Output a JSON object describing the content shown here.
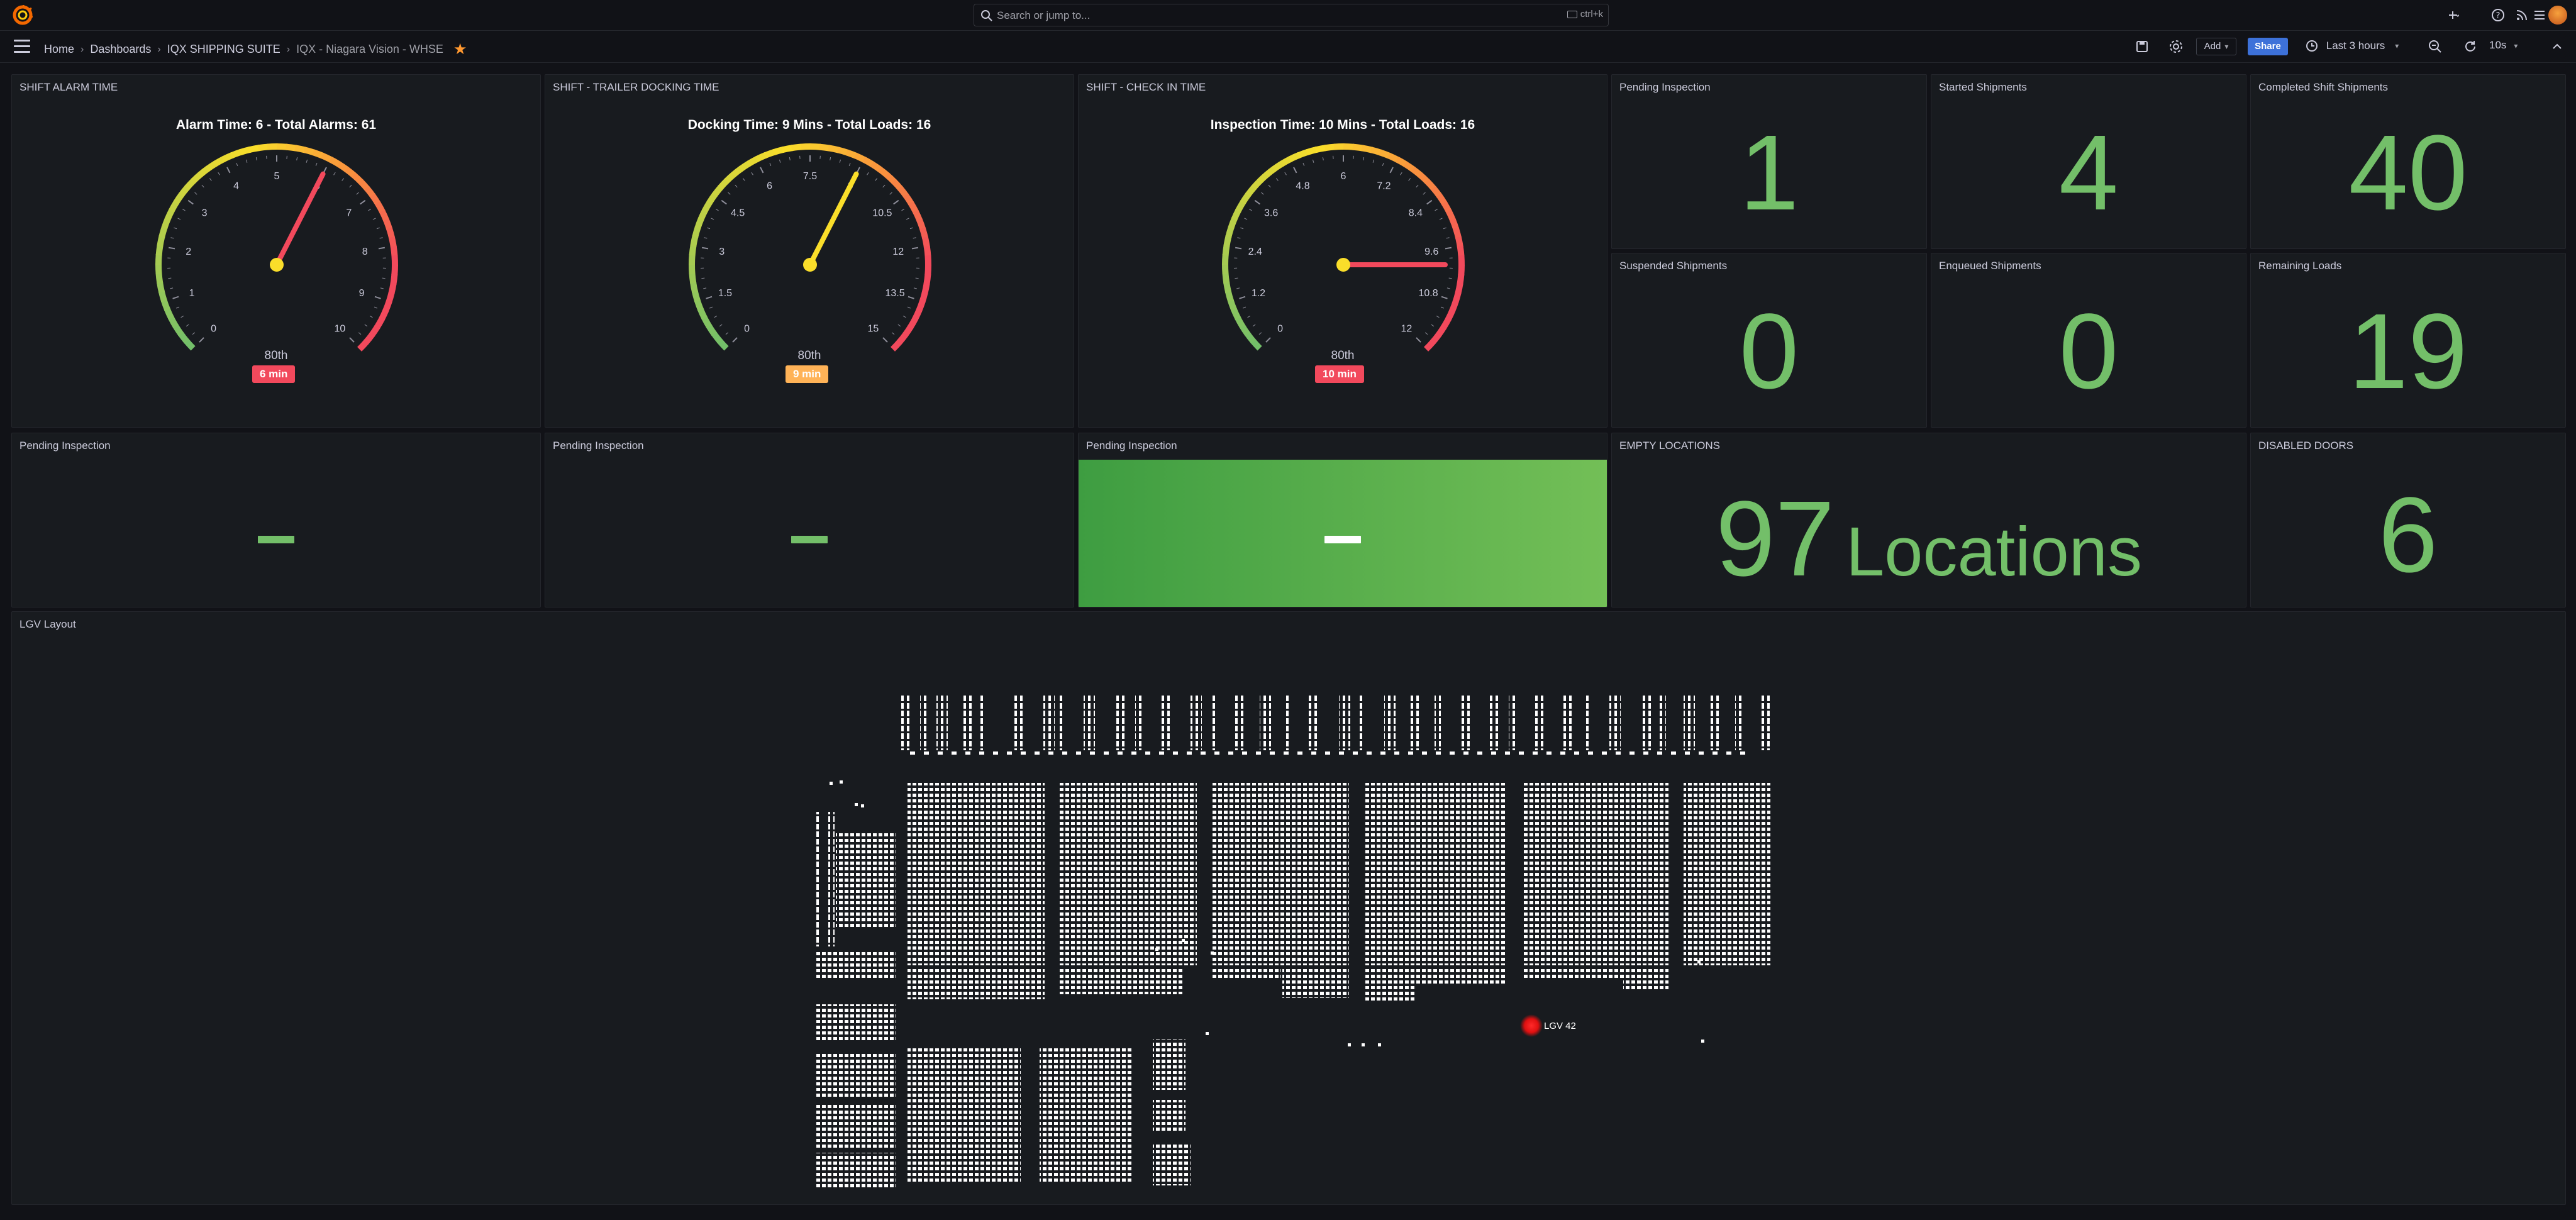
{
  "app": {
    "search_placeholder": "Search or jump to...",
    "search_shortcut": "ctrl+k"
  },
  "breadcrumb": [
    "Home",
    "Dashboards",
    "IQX SHIPPING SUITE",
    "IQX - Niagara Vision - WHSE"
  ],
  "toolbar": {
    "add_label": "Add",
    "share_label": "Share",
    "time_range": "Last 3 hours",
    "refresh_interval": "10s"
  },
  "colors": {
    "stat_green": "#73bf69",
    "gauge_red": "#f2495c",
    "gauge_yellow": "#fade2a",
    "share_blue": "#3d71d9",
    "badge_orange": "#ffb357",
    "star": "#ff9830"
  },
  "gauges": [
    {
      "title": "SHIFT ALARM TIME",
      "subtitle": "Alarm Time: 6 - Total Alarms: 61",
      "value": 6,
      "min": 0,
      "max": 10,
      "ticks": [
        "0",
        "1",
        "2",
        "3",
        "4",
        "5",
        "6",
        "7",
        "8",
        "9",
        "10"
      ],
      "percentile_label": "80th",
      "badge": "6 min",
      "badge_color": "#f2495c",
      "needle_color": "#f2495c"
    },
    {
      "title": "SHIFT - TRAILER DOCKING TIME",
      "subtitle": "Docking Time: 9 Mins - Total Loads: 16",
      "value": 9,
      "min": 0,
      "max": 15,
      "ticks": [
        "0",
        "1.5",
        "3",
        "4.5",
        "6",
        "7.5",
        "9",
        "10.5",
        "12",
        "13.5",
        "15"
      ],
      "percentile_label": "80th",
      "badge": "9 min",
      "badge_color": "#ffb357",
      "needle_color": "#fade2a"
    },
    {
      "title": "SHIFT - CHECK IN TIME",
      "subtitle": "Inspection Time: 10 Mins - Total Loads: 16",
      "value": 10,
      "min": 0,
      "max": 12,
      "ticks": [
        "0",
        "1.2",
        "2.4",
        "3.6",
        "4.8",
        "6",
        "7.2",
        "8.4",
        "9.6",
        "10.8",
        "12"
      ],
      "percentile_label": "80th",
      "badge": "10 min",
      "badge_color": "#f2495c",
      "needle_color": "#f2495c"
    }
  ],
  "stats": {
    "pending_inspection": {
      "title": "Pending Inspection",
      "value": "1"
    },
    "started_shipments": {
      "title": "Started Shipments",
      "value": "4"
    },
    "completed_shift_shipments": {
      "title": "Completed Shift Shipments",
      "value": "40"
    },
    "suspended_shipments": {
      "title": "Suspended Shipments",
      "value": "0"
    },
    "enqueued_shipments": {
      "title": "Enqueued Shipments",
      "value": "0"
    },
    "remaining_loads": {
      "title": "Remaining Loads",
      "value": "19"
    }
  },
  "row2": {
    "pending1": {
      "title": "Pending Inspection",
      "value": "-"
    },
    "pending2": {
      "title": "Pending Inspection",
      "value": "-"
    },
    "pending3": {
      "title": "Pending Inspection",
      "value": "-"
    },
    "empty_locations": {
      "title": "EMPTY LOCATIONS",
      "value": "97",
      "unit": "Locations"
    },
    "disabled_doors": {
      "title": "DISABLED DOORS",
      "value": "6"
    }
  },
  "lgv": {
    "title": "LGV Layout",
    "vehicle_label": "LGV 42"
  }
}
